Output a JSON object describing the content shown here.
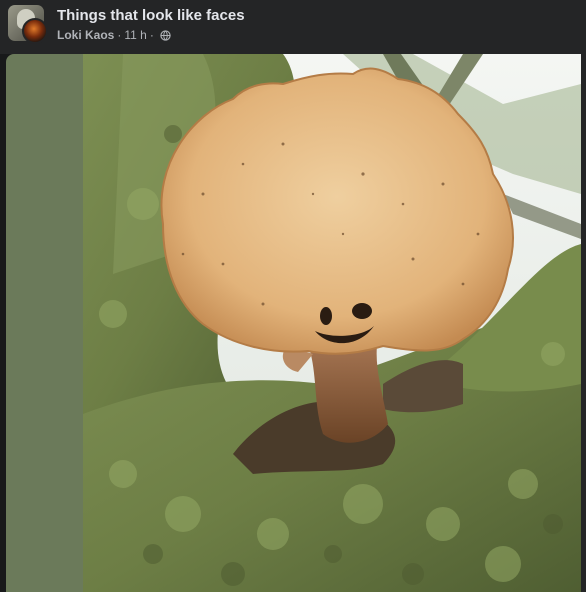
{
  "post": {
    "group_name": "Things that look like faces",
    "author": "Loki Kaos",
    "separator": "·",
    "time": "11 h",
    "time_separator": "·",
    "privacy_icon": "globe-icon"
  },
  "photo": {
    "subject": "bracket-fungus-face-on-tree"
  },
  "colors": {
    "header_bg": "#242526",
    "title_text": "#e4e6eb",
    "meta_text": "#b0b3b8",
    "left_panel": "#6b7a5a"
  }
}
